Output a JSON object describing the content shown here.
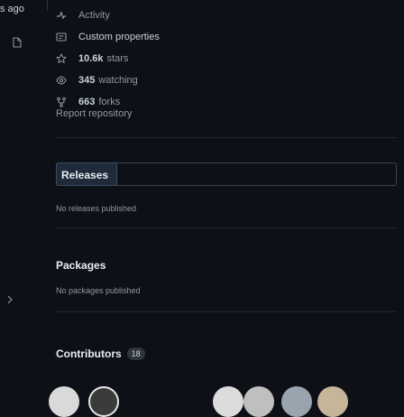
{
  "left": {
    "ago_text": "s ago"
  },
  "about": {
    "items": [
      {
        "icon": "pulse-icon",
        "label": "Activity",
        "count": "",
        "bright": false
      },
      {
        "icon": "custom-properties-icon",
        "label": "Custom properties",
        "count": "",
        "bright": false
      },
      {
        "icon": "star-icon",
        "label": "stars",
        "count": "10.6k",
        "bright": false
      },
      {
        "icon": "eye-icon",
        "label": "watching",
        "count": "345",
        "bright": false
      },
      {
        "icon": "fork-icon",
        "label": "forks",
        "count": "663",
        "bright": false
      }
    ],
    "report": "Report repository"
  },
  "releases": {
    "title": "Releases",
    "note": "No releases published"
  },
  "packages": {
    "title": "Packages",
    "note": "No packages published"
  },
  "contributors": {
    "title": "Contributors",
    "count": "18"
  },
  "colors": {
    "background": "#0d1117",
    "text": "#e6edf3",
    "muted": "#9198a1",
    "border": "#3d444d"
  }
}
